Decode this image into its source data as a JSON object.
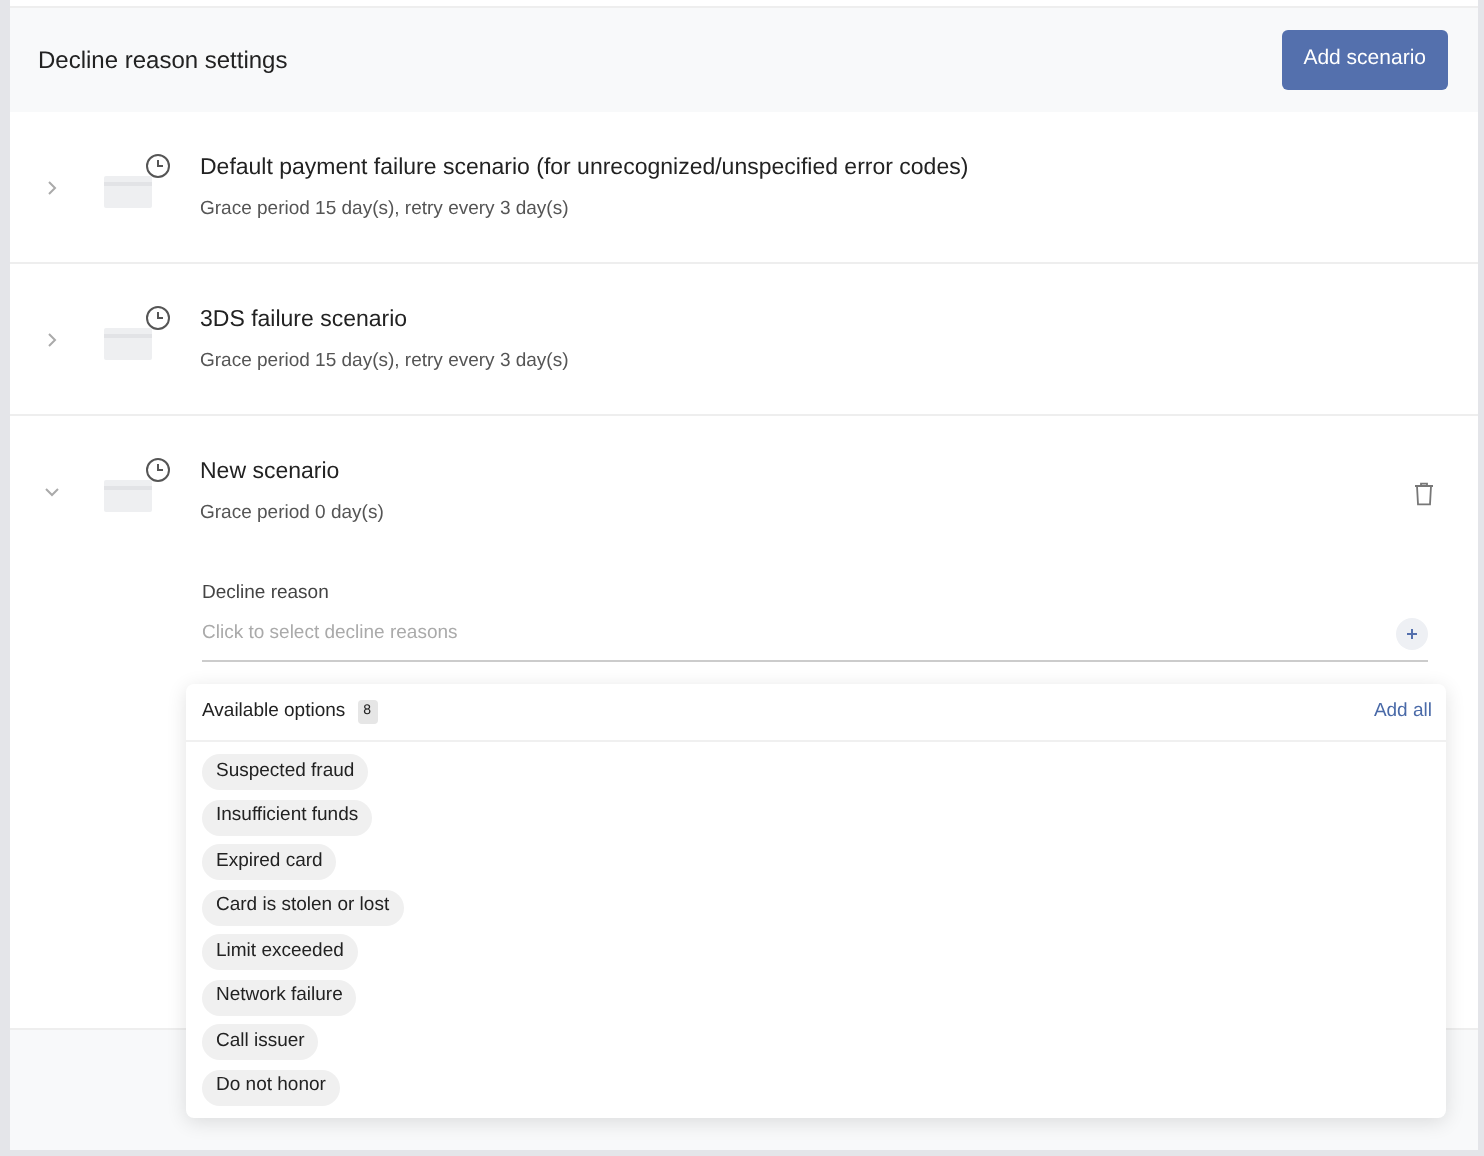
{
  "header": {
    "title": "Decline reason settings",
    "add_button": "Add scenario"
  },
  "scenarios": [
    {
      "title": "Default payment failure scenario (for unrecognized/unspecified error codes)",
      "subtitle": "Grace period 15 day(s), retry every 3 day(s)",
      "expanded": false
    },
    {
      "title": "3DS failure scenario",
      "subtitle": "Grace period 15 day(s), retry every 3 day(s)",
      "expanded": false
    },
    {
      "title": "New scenario",
      "subtitle": "Grace period 0 day(s)",
      "expanded": true,
      "field_label": "Decline reason",
      "placeholder": "Click to select decline reasons"
    }
  ],
  "dropdown": {
    "title": "Available options",
    "count": "8",
    "add_all": "Add all",
    "options": [
      "Suspected fraud",
      "Insufficient funds",
      "Expired card",
      "Card is stolen or lost",
      "Limit exceeded",
      "Network failure",
      "Call issuer",
      "Do not honor"
    ]
  }
}
